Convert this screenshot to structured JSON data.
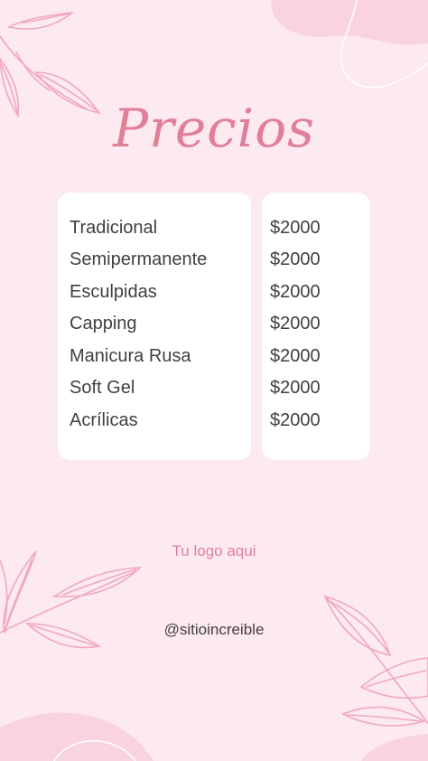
{
  "title": "Precios",
  "items": [
    {
      "name": "Tradicional",
      "price": "$2000"
    },
    {
      "name": "Semipermanente",
      "price": "$2000"
    },
    {
      "name": "Esculpidas",
      "price": "$2000"
    },
    {
      "name": "Capping",
      "price": "$2000"
    },
    {
      "name": "Manicura Rusa",
      "price": "$2000"
    },
    {
      "name": "Soft Gel",
      "price": "$2000"
    },
    {
      "name": "Acrílicas",
      "price": "$2000"
    }
  ],
  "logo_text": "Tu logo aqui",
  "handle": "@sitioincreible",
  "colors": {
    "background": "#fde9f0",
    "accent": "#e27f98",
    "leaf": "#f0a8bd",
    "blob": "#f9d3df",
    "card": "#ffffff",
    "text": "#3f3f3f"
  }
}
